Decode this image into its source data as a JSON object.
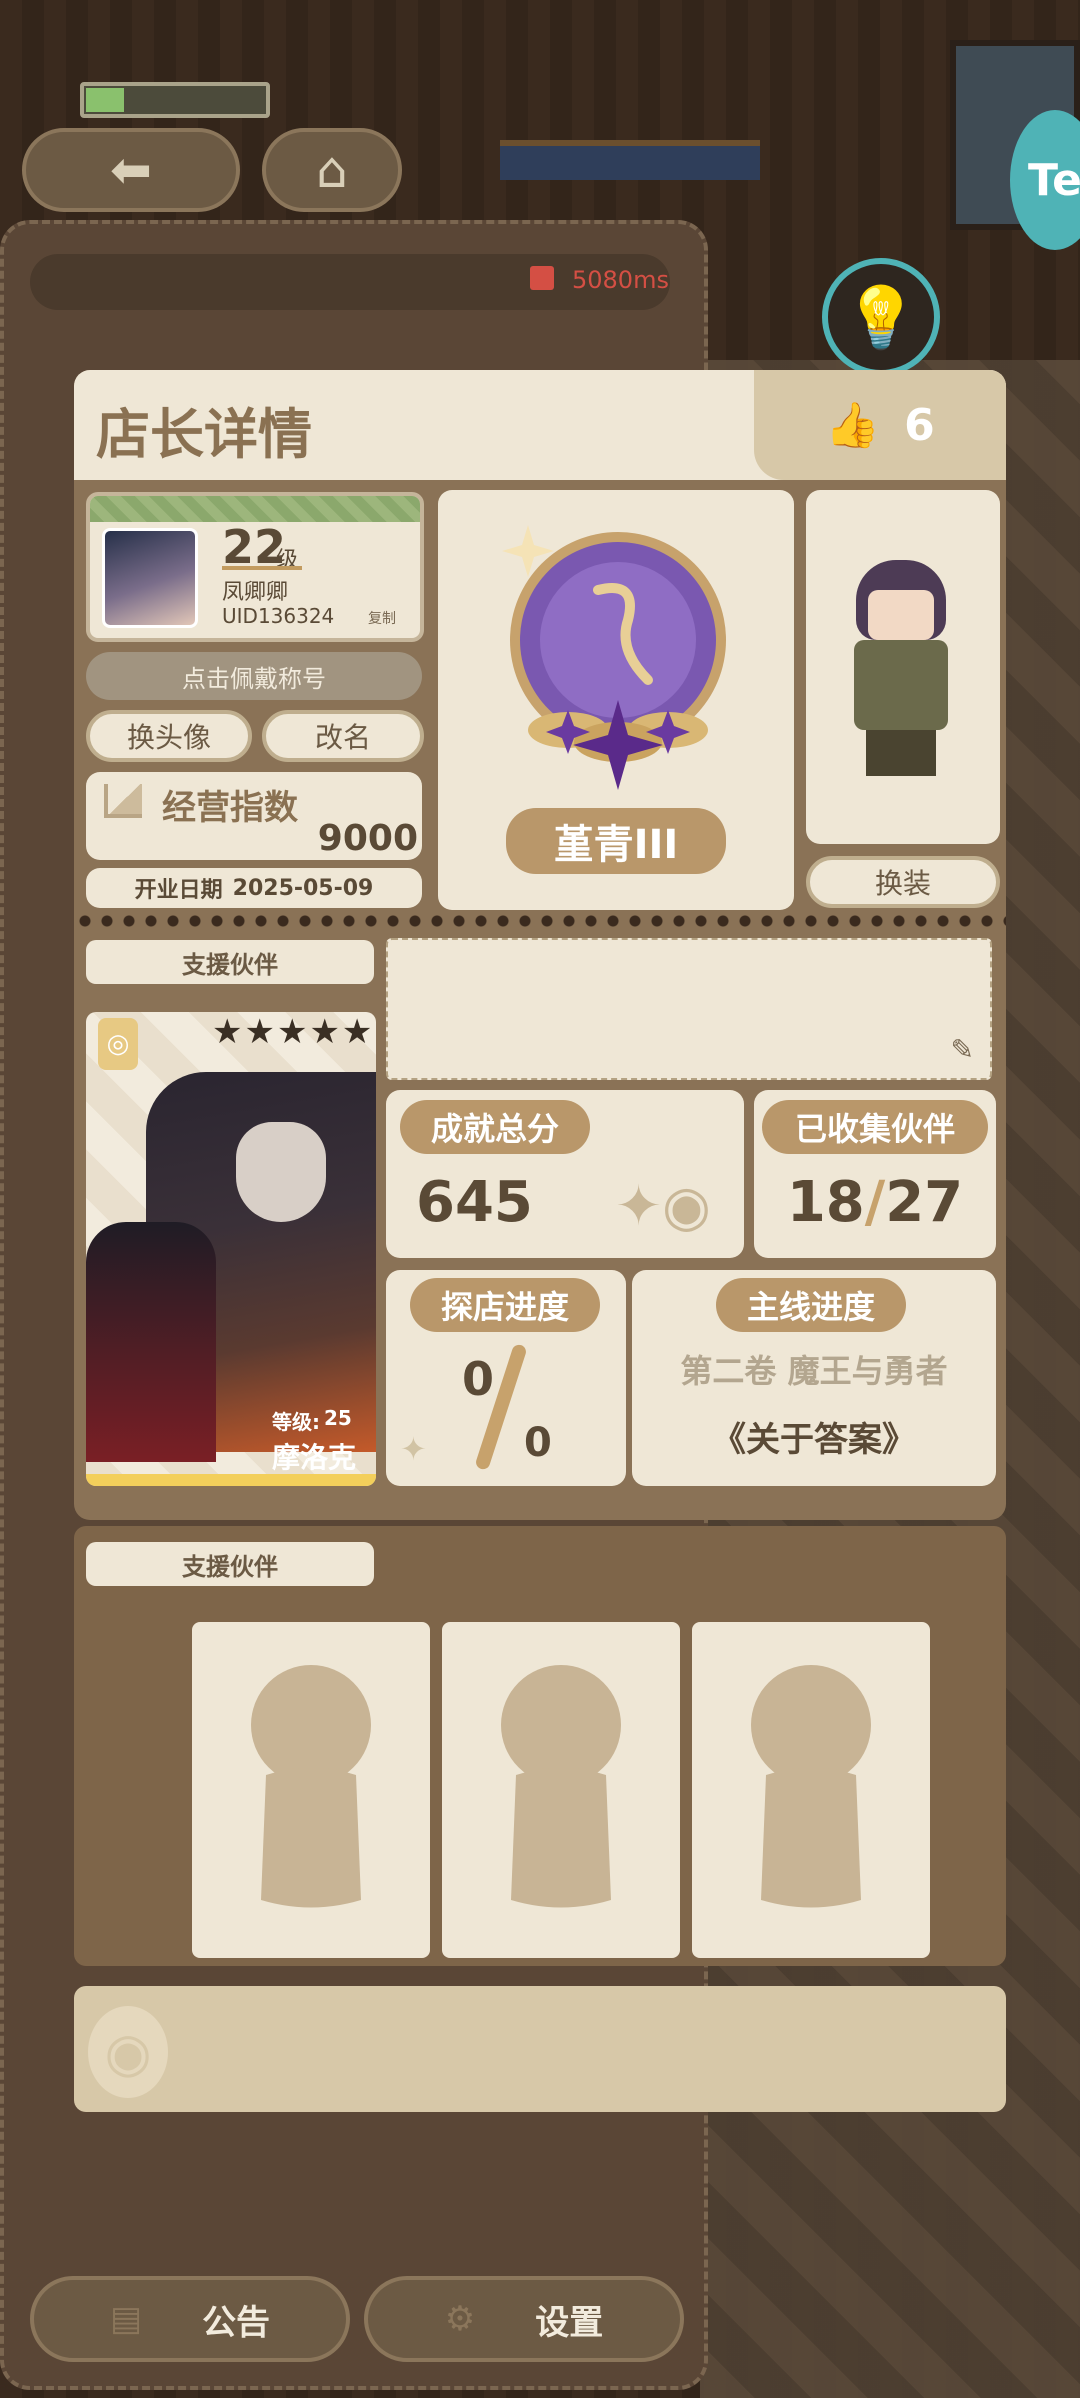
{
  "status": {
    "ping": "5080ms"
  },
  "nav": {
    "back_icon": "arrow-left-icon",
    "home_icon": "home-icon"
  },
  "header": {
    "title": "店长详情",
    "like_count": "6"
  },
  "profile": {
    "level": "22",
    "level_unit": "级",
    "nickname": "凤卿卿",
    "uid": "UID136324",
    "copy_label": "复制"
  },
  "title_button": "点击佩戴称号",
  "buttons": {
    "change_avatar": "换头像",
    "rename": "改名",
    "dress_up": "换装"
  },
  "business": {
    "label": "经营指数",
    "value": "9000"
  },
  "open_date": {
    "label": "开业日期",
    "value": "2025-05-09"
  },
  "rank": {
    "name": "堇青III"
  },
  "support": {
    "label": "支援伙伴",
    "partner": {
      "name": "摩洛克",
      "level_label": "等级:",
      "level": "25",
      "stars": "★★★★★"
    }
  },
  "stats": {
    "achievement": {
      "label": "成就总分",
      "value": "645"
    },
    "collected": {
      "label": "已收集伙伴",
      "value": "18",
      "slash": "/",
      "total": "27"
    },
    "explore": {
      "label": "探店进度",
      "value": "0",
      "total": "0"
    },
    "story": {
      "label": "主线进度",
      "chapter": "第二卷 魔王与勇者",
      "title": "《关于答案》"
    }
  },
  "support2": {
    "label": "支援伙伴"
  },
  "footer": {
    "notice": "公告",
    "settings": "设置"
  },
  "colors": {
    "accent": "#b9976a",
    "panel": "#8a7256",
    "card": "#efe7d6",
    "rank_purple": "#7a58b0"
  }
}
